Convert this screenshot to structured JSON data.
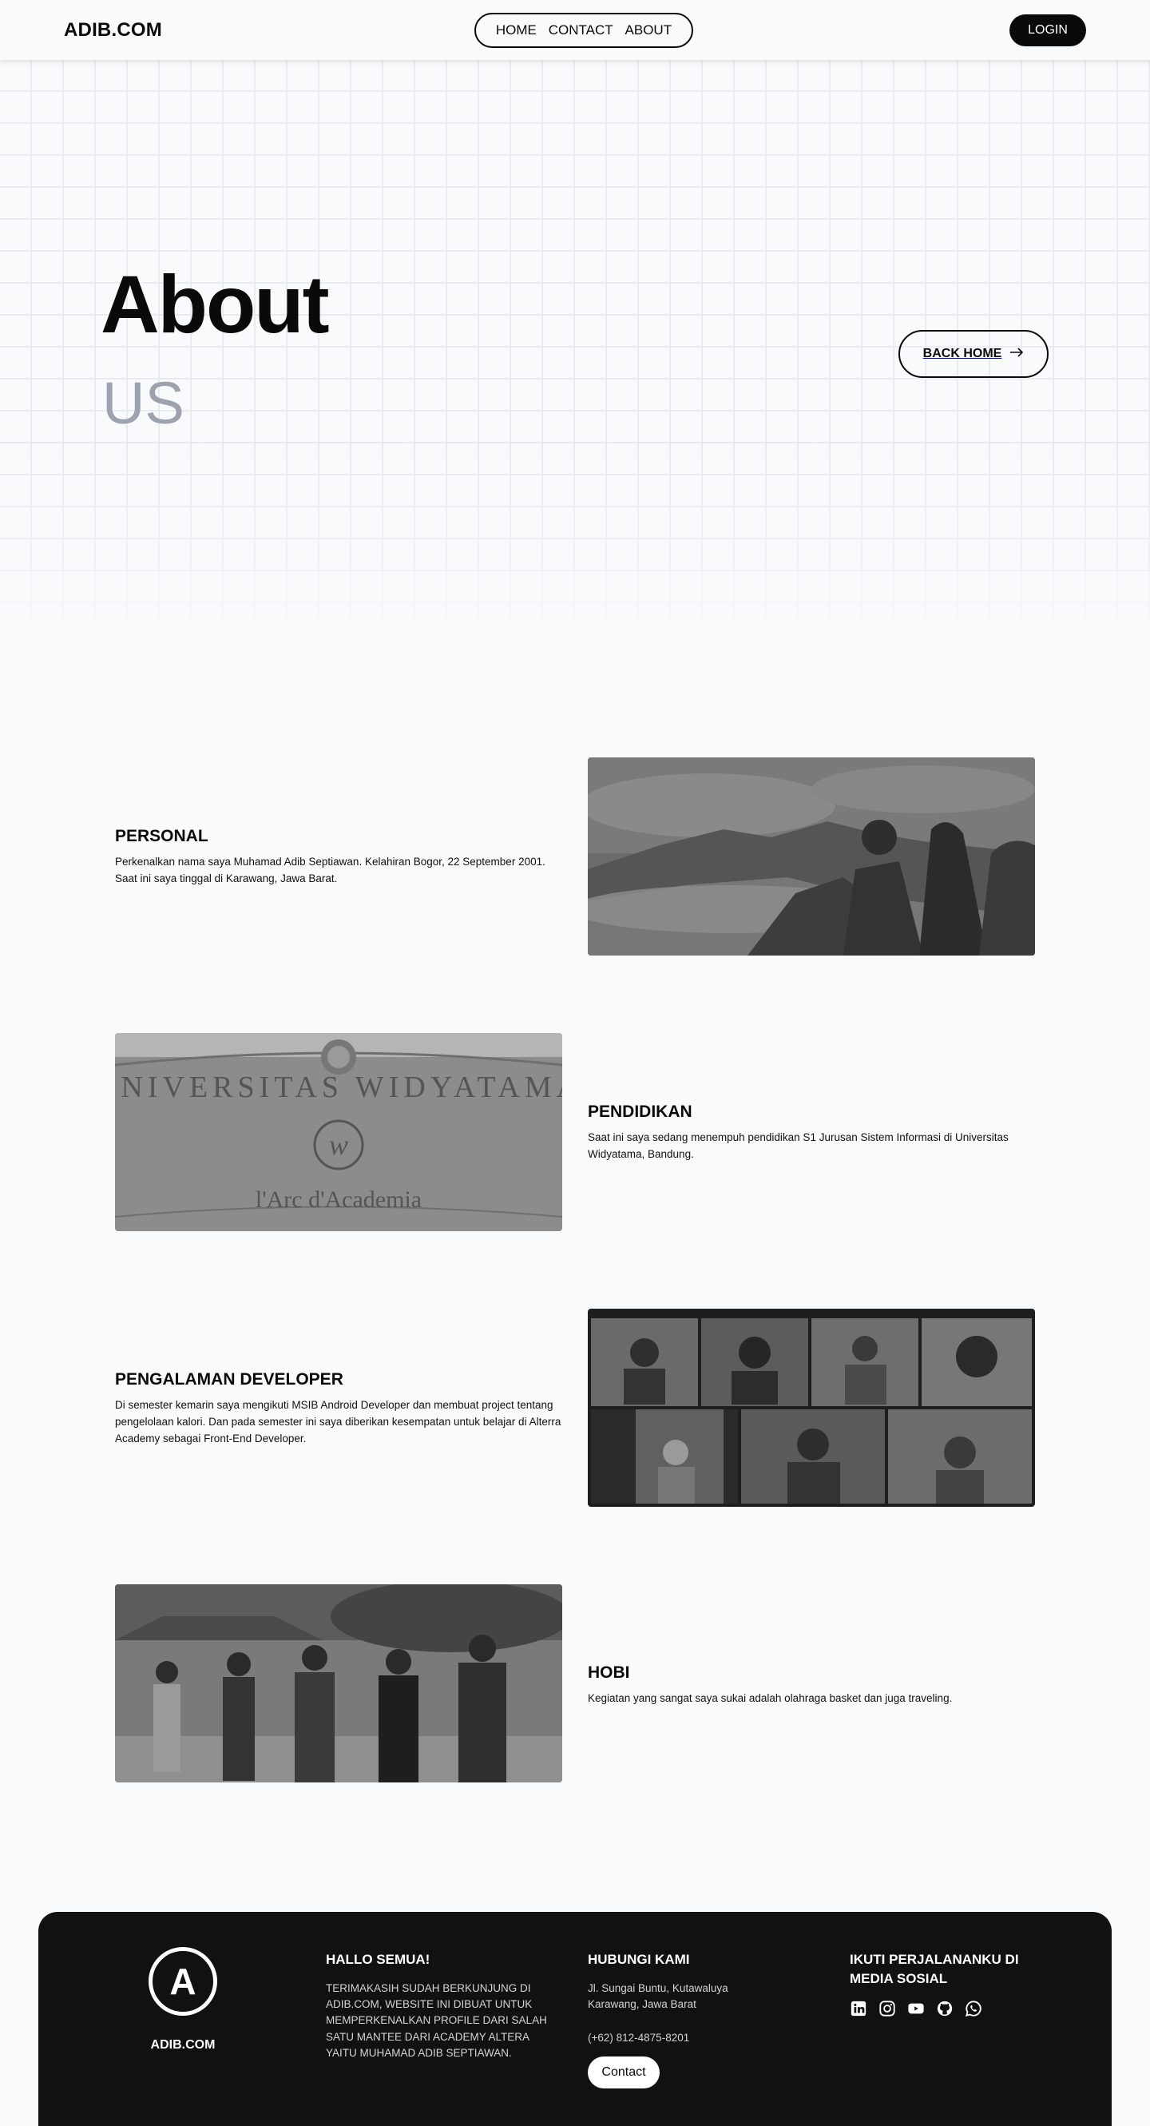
{
  "nav": {
    "brand": "ADIB.COM",
    "links": [
      "HOME",
      "CONTACT",
      "ABOUT"
    ],
    "login": "LOGIN"
  },
  "hero": {
    "title": "About",
    "subtitle": "US",
    "back_home": "BACK HOME"
  },
  "sections": [
    {
      "title": "PERSONAL",
      "text": "Perkenalkan nama saya Muhamad Adib Septiawan. Kelahiran Bogor, 22 September 2001. Saat ini saya tinggal di Karawang, Jawa Barat."
    },
    {
      "title": "PENDIDIKAN",
      "text": "Saat ini saya sedang menempuh pendidikan S1 Jurusan Sistem Informasi di Universitas Widyatama, Bandung.",
      "photo_text_1": "UNIVERSITAS WIDYATAMA",
      "photo_text_2": "l'Arc d'Academia"
    },
    {
      "title": "PENGALAMAN DEVELOPER",
      "text": "Di semester kemarin saya mengikuti MSIB Android Developer dan membuat project tentang pengelolaan kalori. Dan pada semester ini saya diberikan kesempatan untuk belajar di Alterra Academy sebagai Front-End Developer."
    },
    {
      "title": "HOBI",
      "text": "Kegiatan yang sangat saya sukai adalah olahraga basket dan juga traveling."
    }
  ],
  "footer": {
    "logo_letter": "A",
    "brand": "ADIB.COM",
    "greeting_title": "HALLO SEMUA!",
    "greeting_text": "TERIMAKASIH SUDAH BERKUNJUNG DI ADIB.COM, WEBSITE INI DIBUAT UNTUK MEMPERKENALKAN PROFILE DARI SALAH SATU MANTEE DARI ACADEMY ALTERA YAITU MUHAMAD ADIB SEPTIAWAN.",
    "contact_title": "HUBUNGI KAMI",
    "address": "Jl. Sungai Buntu, Kutawaluya Karawang, Jawa Barat",
    "phone": "(+62) 812-4875-8201",
    "contact_button": "Contact",
    "social_title": "IKUTI PERJALANANKU DI MEDIA SOSIAL",
    "social_icons": [
      "linkedin-icon",
      "instagram-icon",
      "youtube-icon",
      "github-icon",
      "whatsapp-icon"
    ]
  }
}
